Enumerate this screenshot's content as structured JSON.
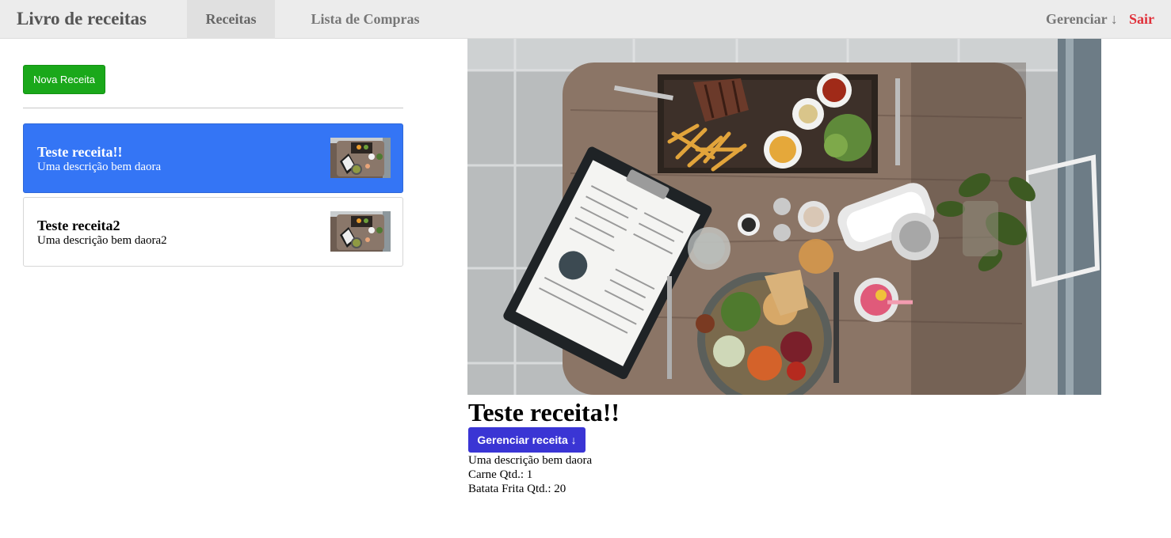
{
  "navbar": {
    "brand": "Livro de receitas",
    "tabs": [
      {
        "label": "Receitas",
        "active": true
      },
      {
        "label": "Lista de Compras",
        "active": false
      }
    ],
    "manage_label": "Gerenciar ↓",
    "logout_label": "Sair",
    "logout_color": "#e0303a"
  },
  "sidebar": {
    "new_button_label": "Nova Receita",
    "new_button_color": "#1aa81a",
    "recipes": [
      {
        "name": "Teste receita!!",
        "description": "Uma descrição bem daora",
        "selected": true
      },
      {
        "name": "Teste receita2",
        "description": "Uma descrição bem daora2",
        "selected": false
      }
    ],
    "selected_color": "#3475f5"
  },
  "detail": {
    "title": "Teste receita!!",
    "manage_button_label": "Gerenciar receita ↓",
    "manage_button_color": "#3a35d4",
    "description": "Uma descrição bem daora",
    "ingredients": [
      {
        "text": "Carne Qtd.: 1"
      },
      {
        "text": "Batata Frita Qtd.: 20"
      }
    ]
  }
}
